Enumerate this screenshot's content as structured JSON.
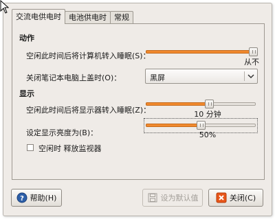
{
  "tabs": [
    {
      "label": "交流电供电时",
      "active": true
    },
    {
      "label": "电池供电时",
      "active": false
    },
    {
      "label": "常规",
      "active": false
    }
  ],
  "actions": {
    "title": "动作",
    "sleep_computer_label": "空闲此时间后将计算机转入睡眠(S)：",
    "sleep_computer_level": 1.0,
    "sleep_computer_value": "从不",
    "lid_label": "关闭笔记本电脑上盖时(O)：",
    "lid_value": "黑屏"
  },
  "display": {
    "title": "显示",
    "sleep_display_label": "空闲此时间后将显示器转入睡眠(Z)：",
    "sleep_display_level": 0.58,
    "sleep_display_value": "10 分钟",
    "brightness_label": "设定显示亮度为(B)：",
    "brightness_percent": 50,
    "brightness_value": "50%",
    "dim_label": "空闲时 释放监视器",
    "dim_checked": false
  },
  "buttons": {
    "help": "帮助(H)",
    "defaults": "设为默认值",
    "close": "关闭(C)"
  },
  "icons": {
    "help": "help-circle-icon",
    "defaults": "save-defaults-icon",
    "close": "close-x-icon",
    "combo": "chevron-down-icon",
    "cursor": "mouse-pointer-icon"
  },
  "colors": {
    "slider_fill": "#f0892e",
    "help_icon": "#2d5fa8",
    "close_icon": "#e8561a"
  }
}
